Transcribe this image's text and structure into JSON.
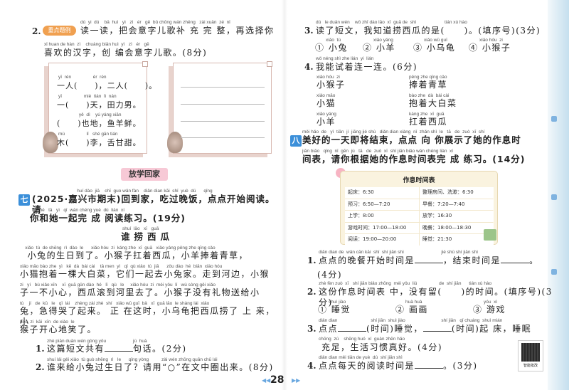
{
  "left": {
    "q2": {
      "number": "2.",
      "badge": "重点题例",
      "py1": "dú  yi  dú    bǎ  huì   yì   zì   ér   gē  bǔ chōng wán zhěng   zài xuǎn  zé  nǐ",
      "hz1": "读一读，把会意字儿歌补 充 完 整，再选择你",
      "py2": "xǐ huan de hàn  zì    chuàng biān huì  yì   zì   ér   gē",
      "hz2": "喜欢的汉字，创 编会意字儿歌。(8分)",
      "rhyme": [
        {
          "py": "yī  rén                 èr  rén",
          "hz": "一人(　　)，二人(　　)。"
        },
        {
          "py": "yī                 miè  tián  lì  nán",
          "hz": "一(　　)天，田力男。"
        },
        {
          "py": "                yě  dì    yú yáng xiān",
          "hz": "(　　)也地，鱼羊鲜。"
        },
        {
          "py": "mù                 lǐ   shé gān tián",
          "hz": "木(　　)李，舌甘甜。"
        }
      ]
    },
    "banner": "放学回家",
    "sec7": {
      "marker": "七",
      "py1": "                                   huí dào  jiā    chī  guo wǎn fàn    diǎn dian kāi  shǐ  yuè  dú      qǐng",
      "hz1": "(2025·嘉兴市期末)回到家，吃过晚饭，点点开始阅读。请",
      "py2": "nǐ   hé   tā   yì   qǐ  wán chéng yuè  dú  liàn  xí",
      "hz2": "你和她一起完 成 阅读练习。(19分)",
      "title_py": "shuí  lāo   xī   guā",
      "title": "谁捞西瓜",
      "story": [
        {
          "py": "    xiǎo  tù  de shēng  rì  dào  le      xiǎo hóu  zi  káng zhe  xī  guā   xiǎo yáng pěng zhe qīng cǎo",
          "hz": "  小兔的生日到了。小猴子扛着西瓜，小羊捧着青草，"
        },
        {
          "py": "xiǎo māo bào zhe  yì   kē  dà  bái cài    tā men  yì   qǐ  qù xiǎo  tù  jiā      zǒu dào  hé  biān  xiǎo hóu",
          "hz": "小猫抱着一棵大白菜，它们一起去小兔家。走到河边，小猴"
        },
        {
          "py": "zi   yí   bù xiǎo xīn    xī  guā gǔn dào  hé   lǐ   qù   le     xiǎo hóu  zi  méi yǒu  lǐ   wù sòng gěi xiǎo",
          "hz": "子一不小心，西瓜滚到河里去了。小猴子没有礼物送给小"
        },
        {
          "py": "tù    jí   de  kū   le   qǐ  lái    zhèng zài zhè  shí   xiǎo wū guī  bǎ   xī  guā lāo  le shàng lái  xiǎo",
          "hz": "兔，急得哭了起来。 正 在这时，小乌龟把西瓜捞了 上 来，小"
        },
        {
          "py": "hóu  zi  kāi  xīn  de xiào  le",
          "hz": "猴子开心地笑了。"
        }
      ],
      "q1": {
        "num": "1.",
        "py": "zhè piān duǎn wén gòng yǒu                     jù  huà",
        "hz_a": "这篇短文共有",
        "hz_b": "句话。(2分)"
      },
      "q2": {
        "num": "2.",
        "py": "shuí lái gěi xiǎo  tù guò shēng  rì   le      qǐng yòng          zài wén zhōng quān chū lái",
        "hz": "谁来给小兔过生日了？请用“○”在文中圈出来。(8分)"
      }
    },
    "page_number": "28"
  },
  "right": {
    "q3": {
      "num": "3.",
      "py": "dú   le duǎn wén    wǒ zhī dào lāo  xī  guā de  shì                      tián xù hào",
      "hz": "读了短文，我知道捞西瓜的是(　　)。(填序号)(3分)",
      "options": [
        {
          "py": "xiǎo  tù",
          "hz": "① 小兔"
        },
        {
          "py": "xiǎo yáng",
          "hz": "② 小羊"
        },
        {
          "py": "xiǎo wū guī",
          "hz": "③ 小乌龟"
        },
        {
          "py": "xiǎo hóu  zi",
          "hz": "④ 小猴子"
        }
      ]
    },
    "q4": {
      "num": "4.",
      "py": "wǒ néng shì zhe lián  yi  lián",
      "hz": "我能试着连一连。(6分)",
      "left": [
        {
          "py": "xiǎo hóu  zi",
          "hz": "小猴子"
        },
        {
          "py": "xiǎo māo",
          "hz": "小猫"
        },
        {
          "py": "xiǎo yáng",
          "hz": "小羊"
        }
      ],
      "right": [
        {
          "py": "pěng zhe qīng cǎo",
          "hz": "捧着青草"
        },
        {
          "py": "bào zhe  dà  bái cài",
          "hz": "抱着大白菜"
        },
        {
          "py": "káng zhe  xī  guā",
          "hz": "扛着西瓜"
        }
      ]
    },
    "sec8": {
      "marker": "八",
      "py1": "měi hǎo  de   yì  tiān  jí  jiāng jié shù   diǎn dian xiàng  nǐ  zhǎn shì  le   tā   de  zuò  xī  shí",
      "hz1": "美好的一天即将结束，点点 向 你展示了她的作息时",
      "py2": "jiān biǎo   qǐng  nǐ  gēn  jù   tā   de  zuò  xī  shí jiān biǎo wán chéng liàn  xí",
      "hz2": "间表，请你根据她的作息时间表完 成 练习。(14分)"
    },
    "schedule": {
      "title": "作息时间表",
      "cells": [
        "起床：6:30",
        "整理房间、洗漱：6:30",
        "预习：6:50—7:20",
        "早餐：7:20—7:40",
        "上学：8:00",
        "放学：16:30",
        "游戏时间：17:00—18:00",
        "晚餐：18:00—18:30",
        "阅读：19:00—20:00",
        "睡觉：21:30"
      ]
    },
    "qs": {
      "q1": {
        "num": "1.",
        "py": "diǎn dian de  wǎn cān kāi  shǐ  shí jiān shì                             jié shù shí jiān shì",
        "hz_a": "点点的晚餐开始时间是",
        "hz_b": "，结束时间是",
        "hz_c": "。",
        "score": "(4分)"
      },
      "q2": {
        "num": "2.",
        "py": "zhè fèn zuò  xī   shí jiān biǎo zhōng  méi yǒu  liú                 de  shí jiān      tián xù hào",
        "hz": "这份作息时间表 中，没有留(　　)的时间。(填序号)(3分)",
        "options": [
          {
            "py": "shuì jiào",
            "hz": "① 睡觉"
          },
          {
            "py": "huà huà",
            "hz": "② 画画"
          },
          {
            "py": "yóu  xì",
            "hz": "③ 游戏"
          }
        ]
      },
      "q3": {
        "num": "3.",
        "py": "diǎn dian                          shí jiān  shuì jiào                            shí jiān   qǐ chuáng  shuì mián",
        "hz_a": "点点",
        "hz_b": "(时间)睡觉，",
        "hz_c": "(时间)起 床，睡眠",
        "py2": "chōng  zú    shēng huó  xí  guàn zhēn hǎo",
        "hz2": "充足，生活习惯真好。(4分)"
      },
      "q4": {
        "num": "4.",
        "py": "diǎn dian měi tiān de yuè  dú  shí jiān shì",
        "hz_a": "点点每天的阅读时间是",
        "hz_b": "。(3分)"
      }
    },
    "qr_label": "智能批改"
  }
}
